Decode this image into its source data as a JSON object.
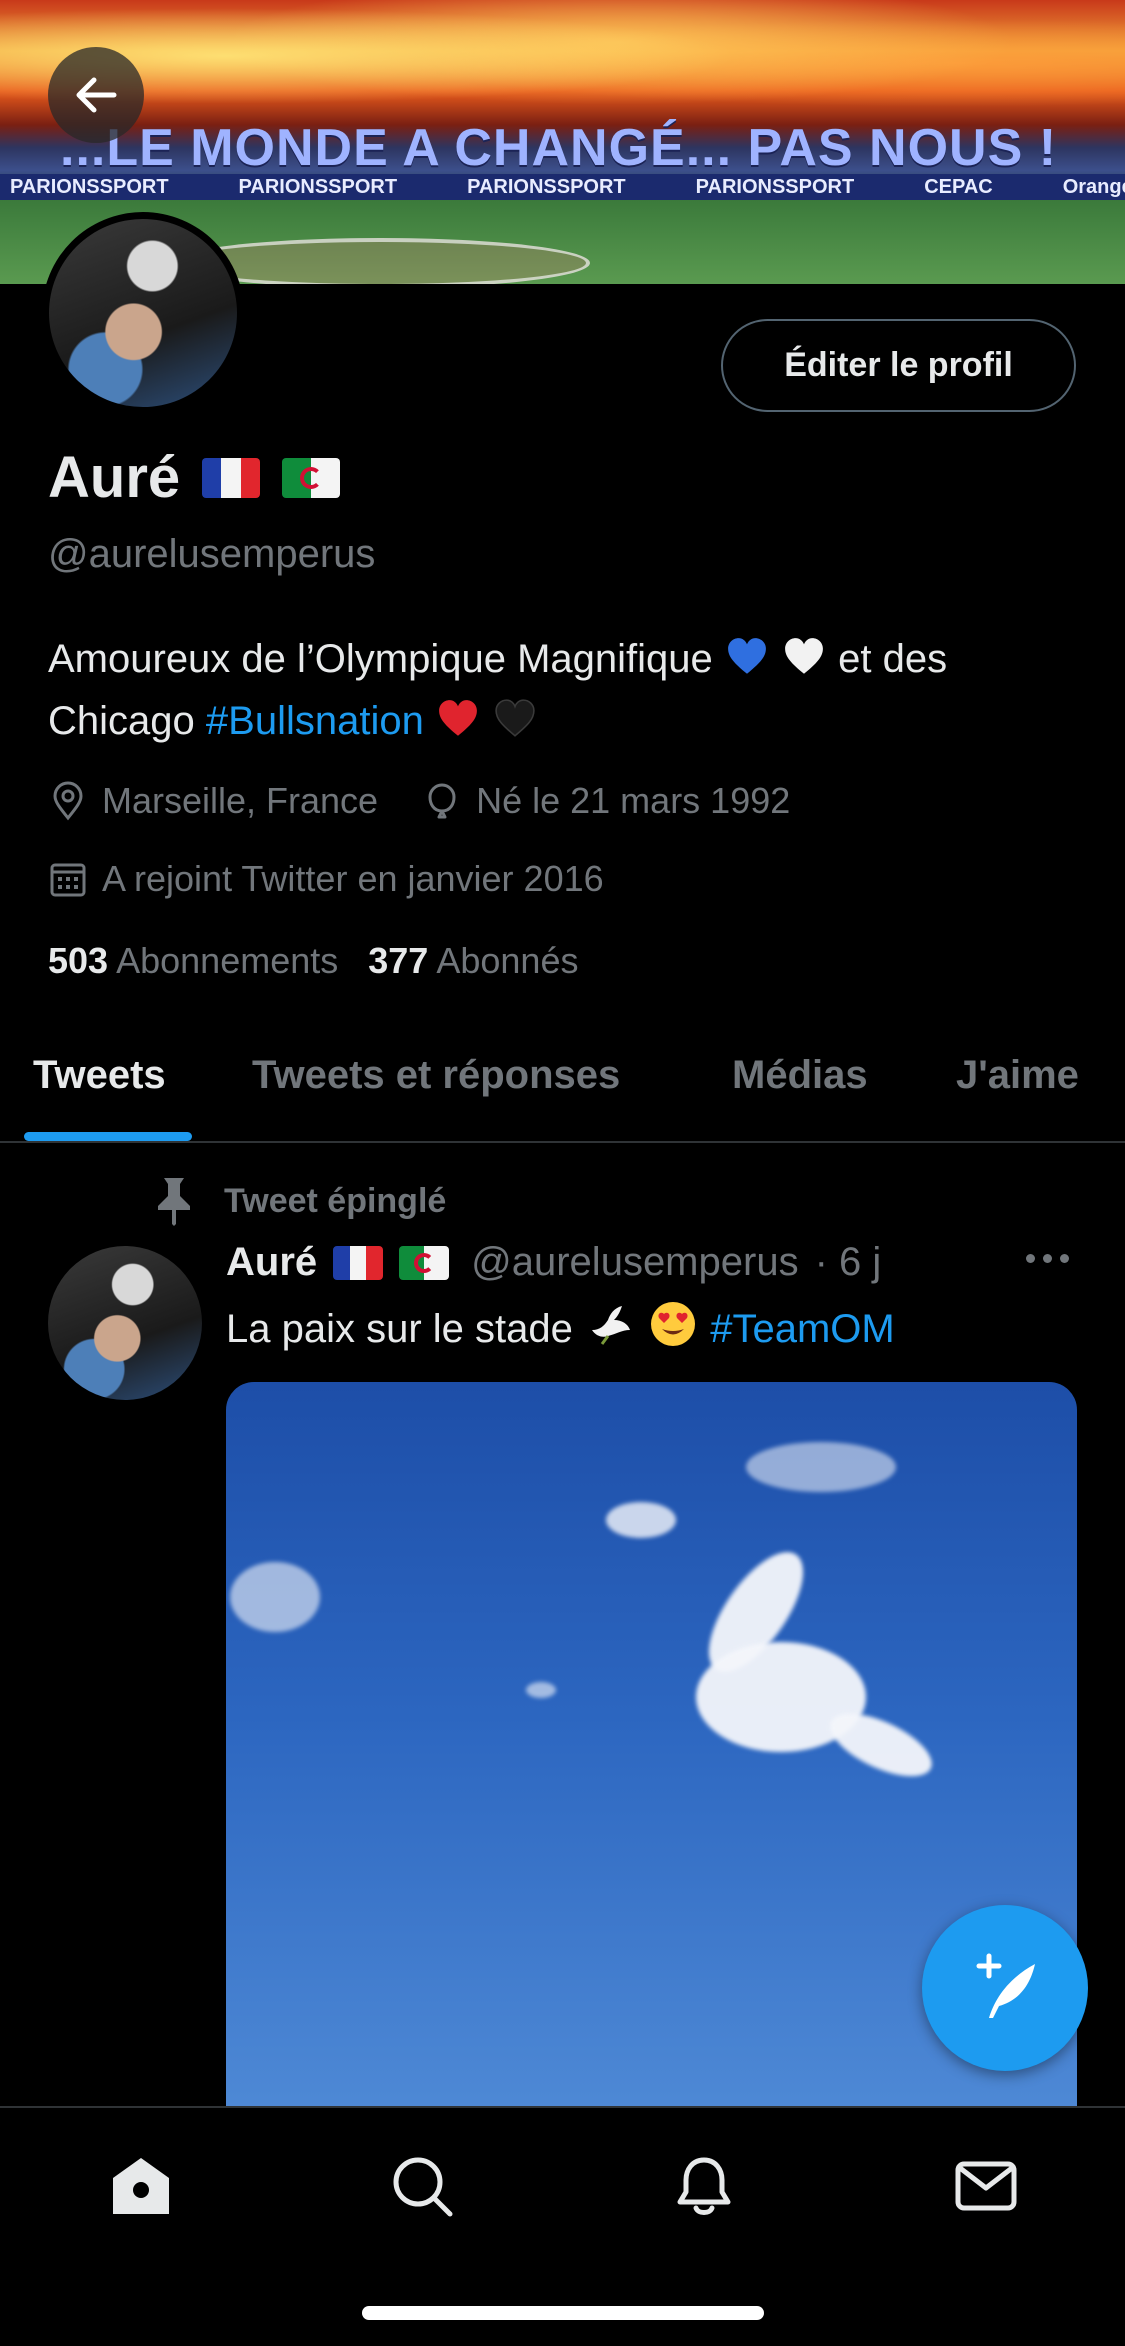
{
  "banner": {
    "slogan": "...LE MONDE A CHANGÉ... PAS NOUS !",
    "ads": [
      "PARIONSSPORT",
      "PARIONSSPORT",
      "PARIONSSPORT",
      "PARIONSSPORT",
      "CEPAC",
      "Orange"
    ]
  },
  "header": {
    "back_icon": "arrow-left-icon",
    "edit_profile_label": "Éditer le profil"
  },
  "profile": {
    "name": "Auré",
    "flags": [
      "france-flag",
      "algeria-flag"
    ],
    "handle": "@aurelusemperus",
    "bio_part1": "Amoureux de l’Olympique Magnifique",
    "bio_part2": "et des",
    "bio_part3": "Chicago",
    "bio_hashtag": "#Bullsnation",
    "location": "Marseille, France",
    "birthday": "Né le 21 mars 1992",
    "joined": "A rejoint Twitter en janvier 2016",
    "following_count": "503",
    "following_label": "Abonnements",
    "followers_count": "377",
    "followers_label": "Abonnés"
  },
  "tabs": [
    {
      "label": "Tweets",
      "active": true
    },
    {
      "label": "Tweets et réponses",
      "active": false
    },
    {
      "label": "Médias",
      "active": false
    },
    {
      "label": "J'aime",
      "active": false
    }
  ],
  "tweet": {
    "pinned_label": "Tweet épinglé",
    "author": "Auré",
    "handle": "@aurelusemperus",
    "time": "· 6 j",
    "text": "La paix sur le stade",
    "hashtag": "#TeamOM"
  },
  "bottom_nav": [
    "home-icon",
    "search-icon",
    "notifications-icon",
    "messages-icon"
  ],
  "colors": {
    "accent": "#1d9bf0",
    "background": "#000000",
    "text_primary": "#e7e9ea",
    "text_secondary": "#71767b",
    "border": "#2f3336"
  }
}
